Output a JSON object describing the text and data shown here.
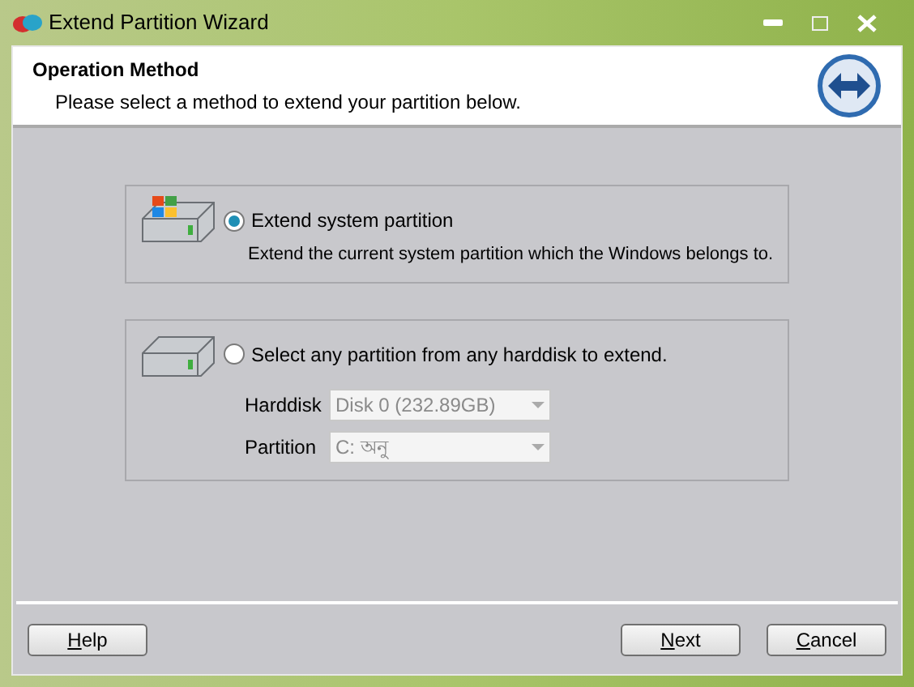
{
  "window": {
    "title": "Extend Partition Wizard"
  },
  "header": {
    "title": "Operation Method",
    "subtitle": "Please select a method to extend your partition below."
  },
  "options": [
    {
      "label": "Extend system partition",
      "selected": true,
      "description": "Extend the current system partition which the Windows belongs to.",
      "kind": "system"
    },
    {
      "label": "Select any partition from any harddisk to extend.",
      "selected": false,
      "kind": "disk",
      "fields": [
        {
          "label": "Harddisk",
          "value": "Disk 0 (232.89GB)",
          "disabled": true
        },
        {
          "label": "Partition",
          "value": "C: অনু",
          "disabled": true
        }
      ]
    }
  ],
  "buttons": [
    {
      "key": "H",
      "rest": "elp"
    },
    {
      "key": "N",
      "rest": "ext"
    },
    {
      "key": "C",
      "rest": "ancel"
    }
  ]
}
